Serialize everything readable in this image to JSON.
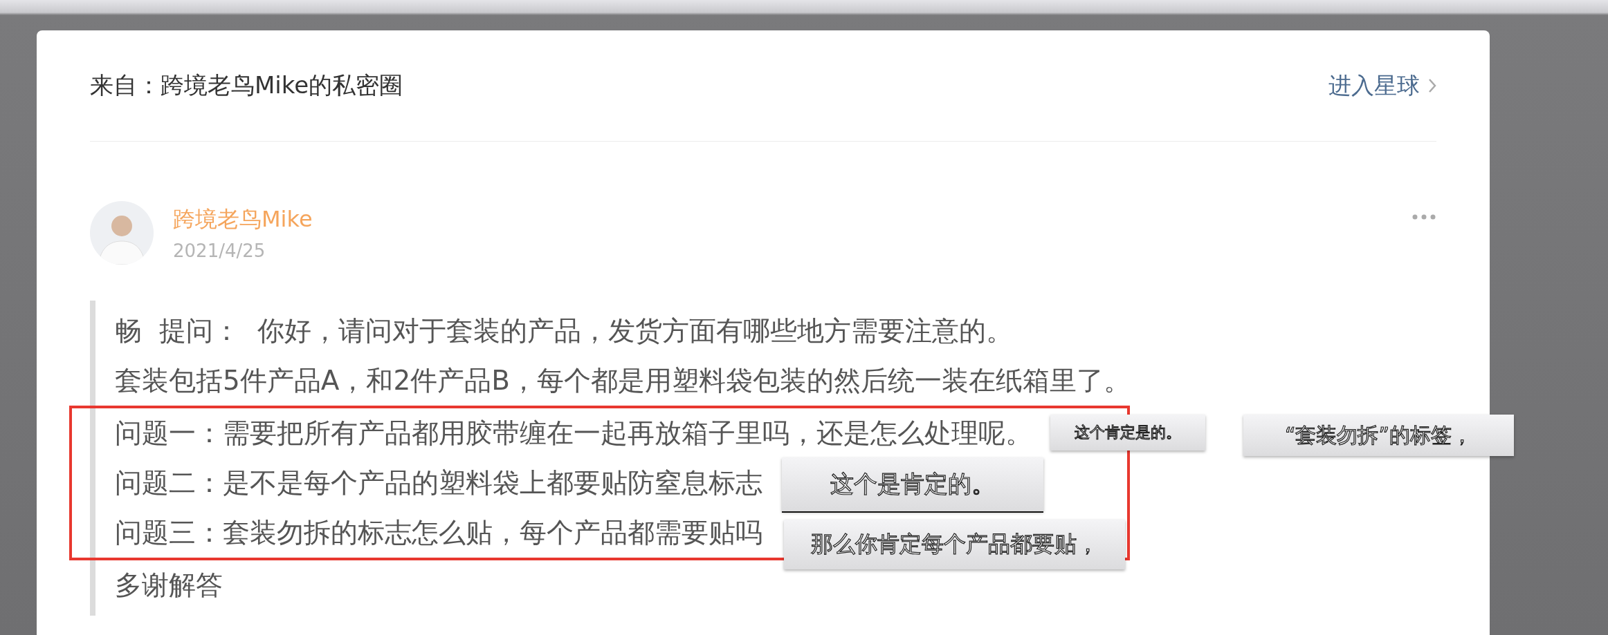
{
  "source": {
    "label": "来自：跨境老鸟Mike的私密圈",
    "link": "进入星球"
  },
  "post": {
    "author": "跨境老鸟Mike",
    "date": "2021/4/25",
    "lines": [
      {
        "text": "畅  提问：  你好，请问对于套装的产品，发货方面有哪些地方需要注意的。",
        "highlighted": false
      },
      {
        "text": "套装包括5件产品A，和2件产品B，每个都是用塑料袋包装的然后统一装在纸箱里了。",
        "highlighted": false
      },
      {
        "text": "问题一：需要把所有产品都用胶带缠在一起再放箱子里吗，还是怎么处理呢。",
        "highlighted": true
      },
      {
        "text": "问题二：是不是每个产品的塑料袋上都要贴防窒息标志",
        "highlighted": true
      },
      {
        "text": "问题三：套装勿拆的标志怎么贴，每个产品都需要贴吗",
        "highlighted": true
      },
      {
        "text": "多谢解答",
        "highlighted": false
      }
    ]
  },
  "captions": [
    {
      "text": "这个肯定是的。"
    },
    {
      "text": "“套装勿拆”的标签，"
    },
    {
      "text": "这个是肯定的。"
    },
    {
      "text": "那么你肯定每个产品都要贴，"
    }
  ]
}
